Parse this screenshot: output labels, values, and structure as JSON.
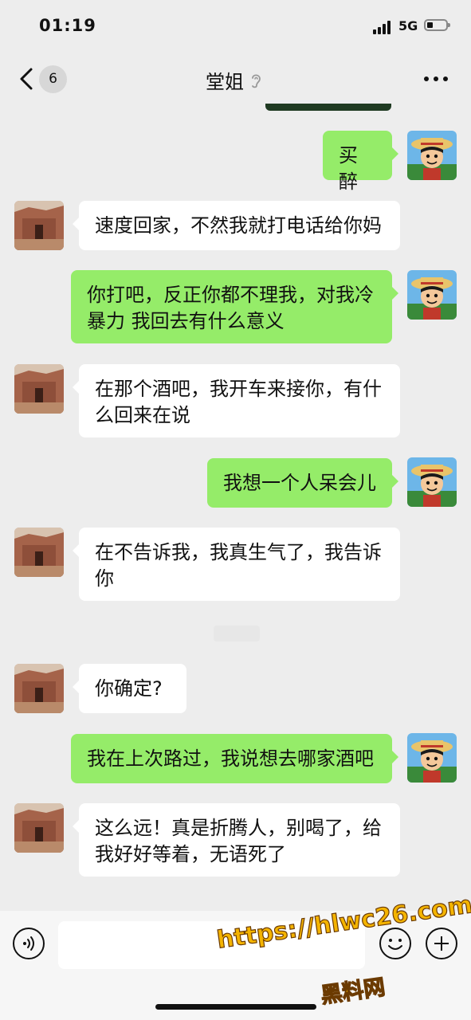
{
  "status_bar": {
    "time": "01:19",
    "network": "5G"
  },
  "nav": {
    "unread_count": "6",
    "title": "堂姐"
  },
  "messages": [
    {
      "side": "right",
      "text": "买醉"
    },
    {
      "side": "left",
      "text": "速度回家，不然我就打电话给你妈"
    },
    {
      "side": "right",
      "text": "你打吧，反正你都不理我，对我冷暴力 我回去有什么意义"
    },
    {
      "side": "left",
      "text": "在那个酒吧，我开车来接你，有什么回来在说"
    },
    {
      "side": "right",
      "text": "我想一个人呆会儿"
    },
    {
      "side": "left",
      "text": "在不告诉我，我真生气了，我告诉你"
    },
    {
      "side": "left",
      "text": "你确定?"
    },
    {
      "side": "right",
      "text": "我在上次路过，我说想去哪家酒吧"
    },
    {
      "side": "left",
      "text": "这么远！真是折腾人，别喝了，给我好好等着，无语死了"
    }
  ],
  "watermark": {
    "url": "https://hlwc26.com",
    "site": "黑料网"
  },
  "colors": {
    "background": "#ededed",
    "bubble_self": "#95ec69",
    "bubble_other": "#ffffff"
  },
  "icons": [
    "back-chevron-icon",
    "ear-icon",
    "more-icon",
    "voice-icon",
    "emoji-icon",
    "plus-icon"
  ]
}
